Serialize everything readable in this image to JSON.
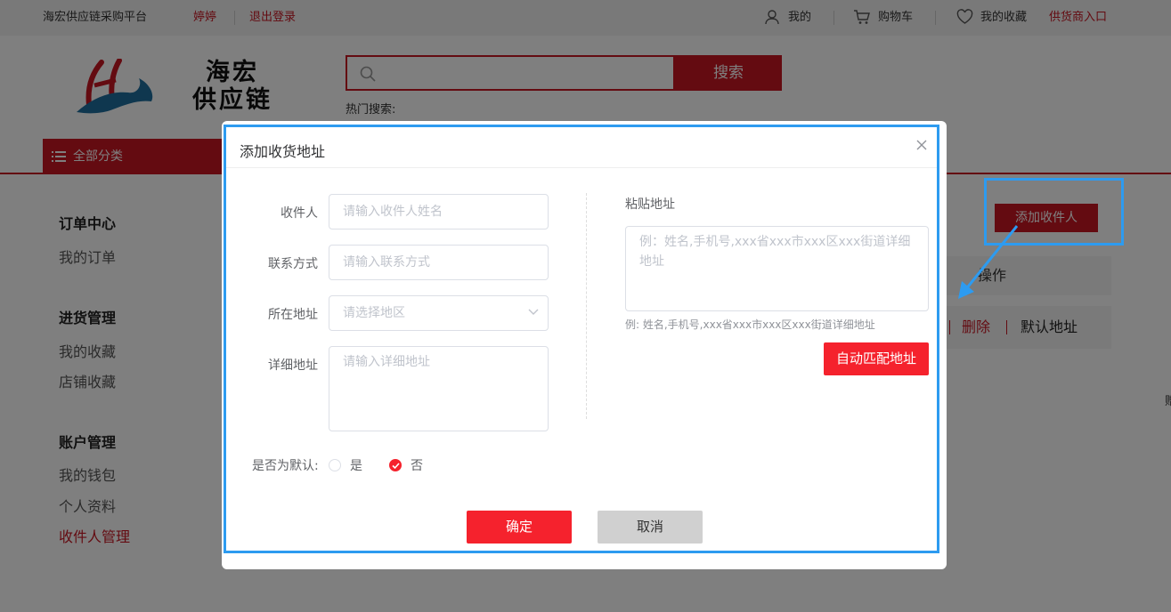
{
  "topbar": {
    "platform": "海宏供应链采购平台",
    "username": "婷婷",
    "logout": "退出登录",
    "my": "我的",
    "cart": "购物车",
    "favorites": "我的收藏",
    "supplier_entry": "供货商入口"
  },
  "header": {
    "logo_line1": "海宏",
    "logo_line2": "供应链",
    "search_button": "搜索",
    "hot_search": "热门搜索:"
  },
  "nav": {
    "all_categories": "全部分类"
  },
  "sidebar": {
    "sections": [
      {
        "title": "订单中心",
        "items": [
          "我的订单"
        ]
      },
      {
        "title": "进货管理",
        "items": [
          "我的收藏",
          "店铺收藏"
        ]
      },
      {
        "title": "账户管理",
        "items": [
          "我的钱包",
          "个人资料",
          "收件人管理"
        ]
      }
    ]
  },
  "content": {
    "add_recipient": "添加收件人",
    "operation_header": "操作",
    "delete": "删除",
    "set_default": "默认地址",
    "edge_char": "赠"
  },
  "dialog": {
    "title": "添加收货地址",
    "recipient_label": "收件人",
    "recipient_placeholder": "请输入收件人姓名",
    "contact_label": "联系方式",
    "contact_placeholder": "请输入联系方式",
    "region_label": "所在地址",
    "region_placeholder": "请选择地区",
    "detail_label": "详细地址",
    "detail_placeholder": "请输入详细地址",
    "paste_label": "粘贴地址",
    "paste_placeholder": "例：姓名,手机号,xxx省xxx市xxx区xxx街道详细地址",
    "paste_hint": "例: 姓名,手机号,xxx省xxx市xxx区xxx街道详细地址",
    "auto_match": "自动匹配地址",
    "default_label": "是否为默认:",
    "yes": "是",
    "no": "否",
    "default_selected": "否",
    "confirm": "确定",
    "cancel": "取消"
  },
  "colors": {
    "brand_red": "#c81623",
    "button_red": "#f5222d",
    "highlight_blue": "#2d9bf0"
  }
}
